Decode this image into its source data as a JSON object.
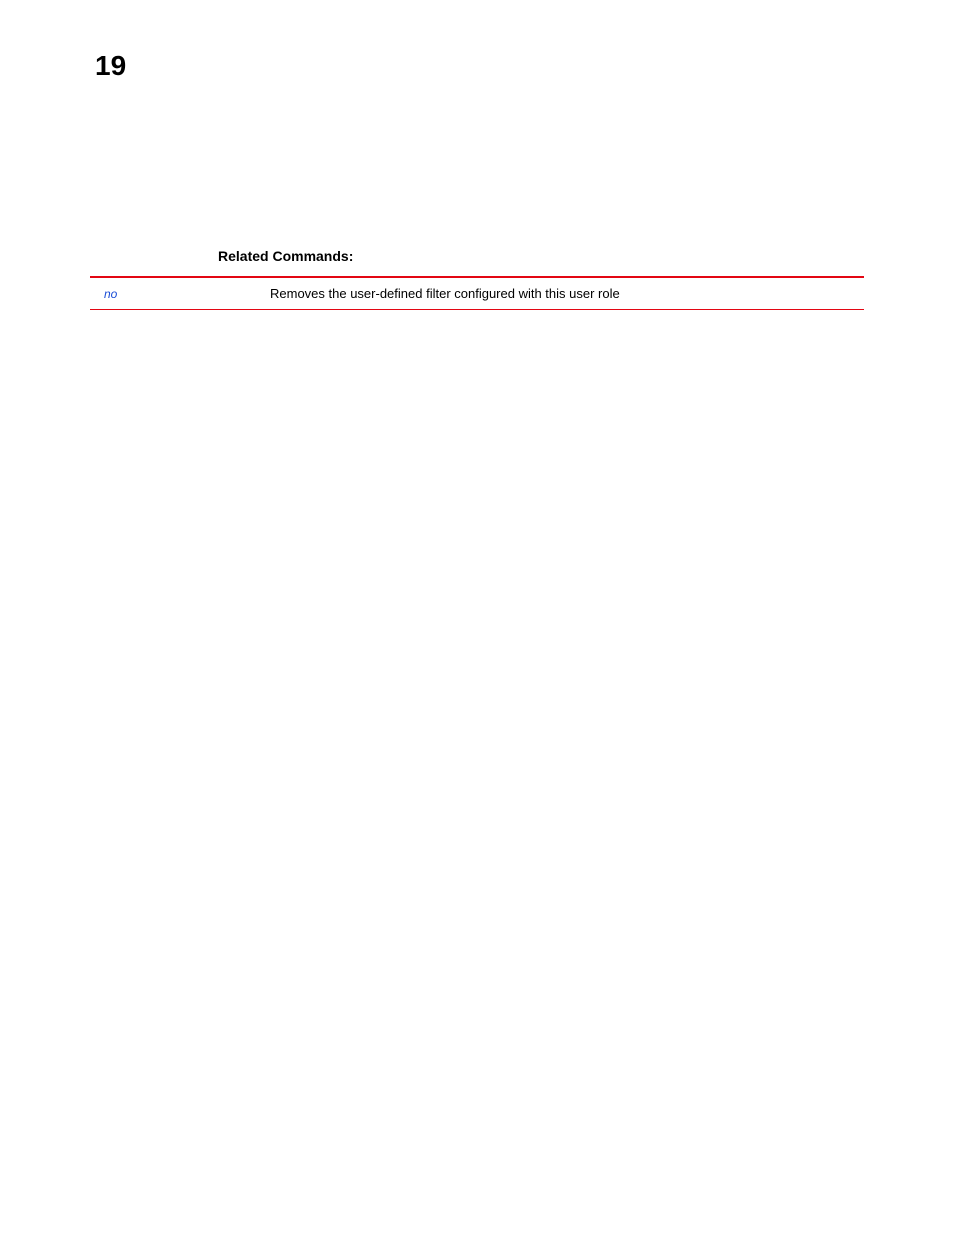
{
  "page": {
    "number": "19"
  },
  "section": {
    "heading": "Related Commands:"
  },
  "commands": [
    {
      "name": "no",
      "description": "Removes the user-defined filter configured with this user role"
    }
  ]
}
